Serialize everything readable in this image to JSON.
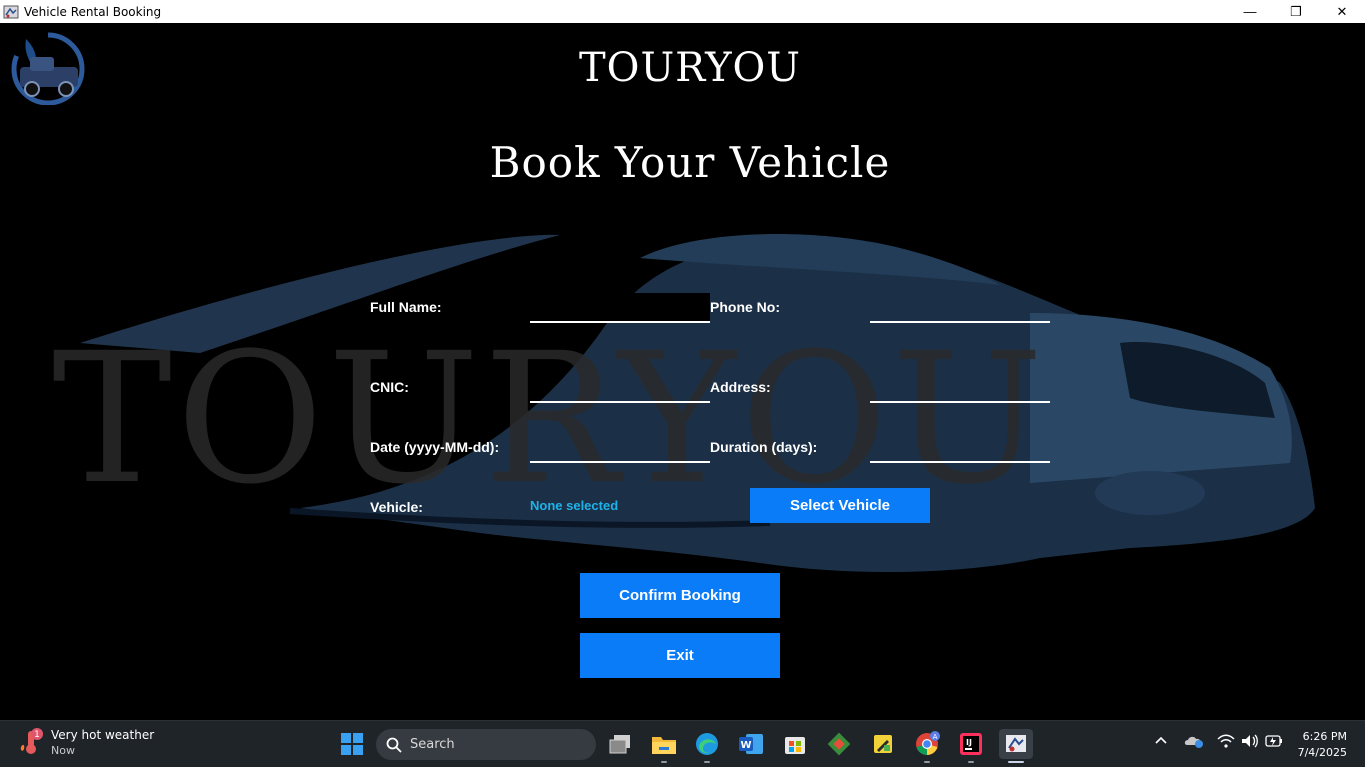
{
  "window": {
    "title": "Vehicle Rental Booking",
    "minimize": "—",
    "restore": "❐",
    "close": "✕"
  },
  "app": {
    "brand": "TOURYOU",
    "heading": "Book Your Vehicle",
    "watermark_text": "TOURYOU",
    "form": {
      "full_name_label": "Full Name:",
      "full_name_value": "",
      "phone_label": "Phone No:",
      "phone_value": "",
      "cnic_label": "CNIC:",
      "cnic_value": "",
      "address_label": "Address:",
      "address_value": "",
      "date_label": "Date (yyyy-MM-dd):",
      "date_value": "",
      "duration_label": "Duration (days):",
      "duration_value": "",
      "vehicle_label": "Vehicle:",
      "vehicle_value": "None selected"
    },
    "buttons": {
      "select_vehicle": "Select Vehicle",
      "confirm_booking": "Confirm Booking",
      "exit": "Exit"
    },
    "colors": {
      "button": "#0a7cf7",
      "vehicle_value": "#1fb2ea",
      "background": "#000000"
    }
  },
  "taskbar": {
    "weather_title": "Very hot weather",
    "weather_sub": "Now",
    "weather_badge": "1",
    "search_placeholder": "Search",
    "time": "6:26 PM",
    "date": "7/4/2025",
    "icons": [
      "start-icon",
      "task-view-icon",
      "file-explorer-icon",
      "edge-icon",
      "word-icon",
      "store-icon",
      "git-icon",
      "pencil-tool-icon",
      "chrome-icon",
      "intellij-icon",
      "java-app-icon"
    ],
    "tray_icons": [
      "chevron-up-icon",
      "onedrive-icon",
      "wifi-icon",
      "volume-icon",
      "battery-icon"
    ]
  }
}
